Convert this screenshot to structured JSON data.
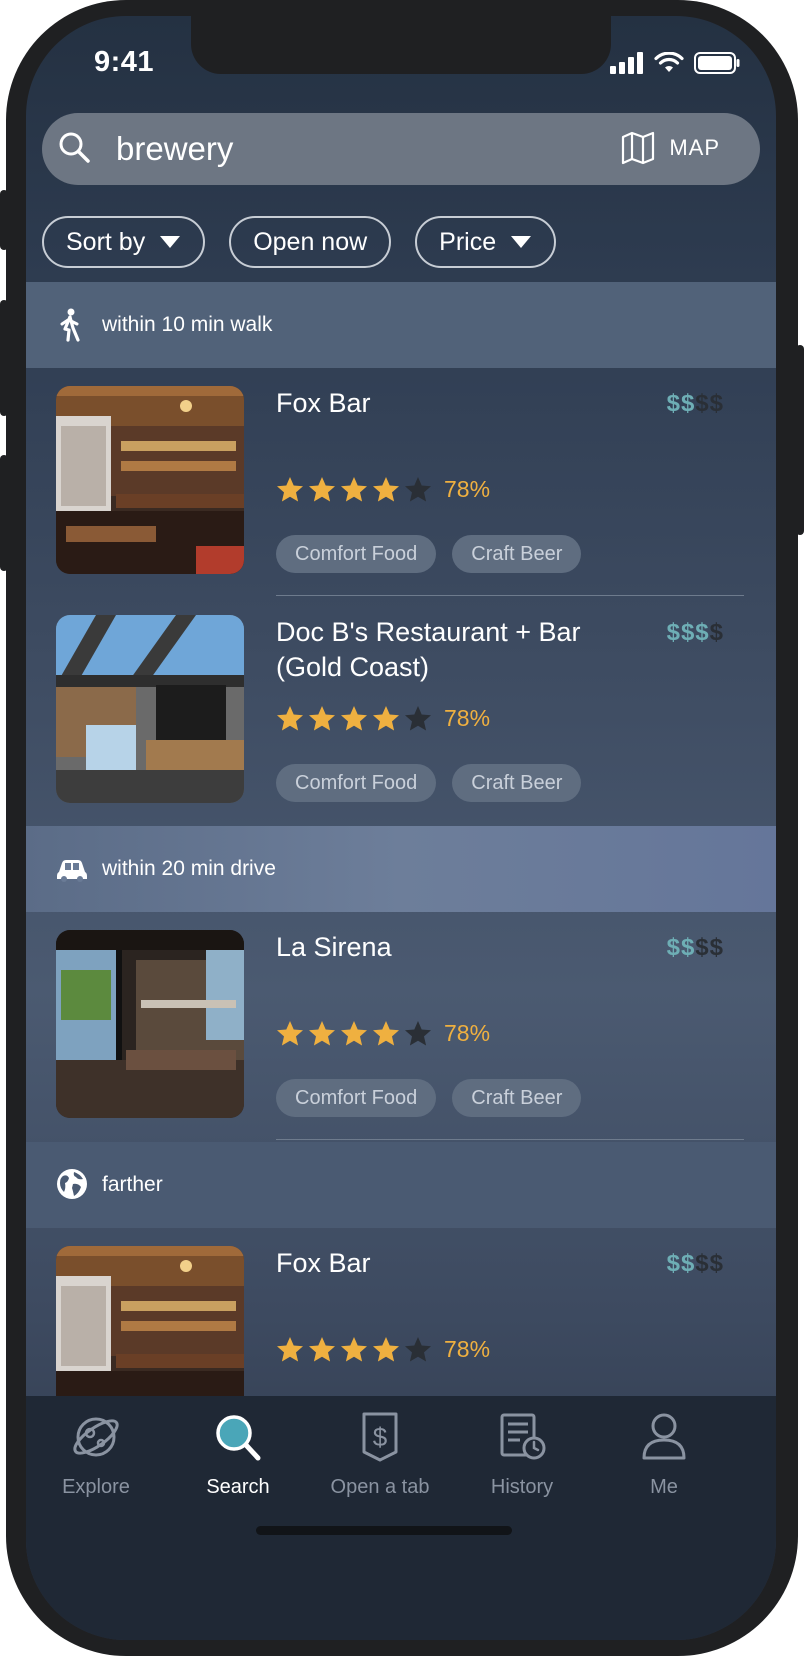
{
  "status_bar": {
    "time": "9:41"
  },
  "search": {
    "query": "brewery",
    "map_label": "MAP"
  },
  "filters": [
    {
      "label": "Sort by",
      "has_dropdown": true
    },
    {
      "label": "Open now",
      "has_dropdown": false
    },
    {
      "label": "Price",
      "has_dropdown": true
    }
  ],
  "sections": [
    {
      "label": "within 10 min walk",
      "icon": "walk-icon"
    },
    {
      "label": "within 20 min drive",
      "icon": "car-icon"
    },
    {
      "label": "farther",
      "icon": "globe-icon"
    }
  ],
  "results": [
    {
      "name": "Fox Bar",
      "price_level": 2,
      "price_max": 4,
      "rating_stars": 4,
      "rating_max": 5,
      "rating_pct": "78%",
      "tags": [
        "Comfort Food",
        "Craft Beer"
      ]
    },
    {
      "name": "Doc B's Restaurant + Bar (Gold Coast)",
      "price_level": 3,
      "price_max": 4,
      "rating_stars": 4,
      "rating_max": 5,
      "rating_pct": "78%",
      "tags": [
        "Comfort Food",
        "Craft Beer"
      ]
    },
    {
      "name": "La Sirena",
      "price_level": 2,
      "price_max": 4,
      "rating_stars": 4,
      "rating_max": 5,
      "rating_pct": "78%",
      "tags": [
        "Comfort Food",
        "Craft Beer"
      ]
    },
    {
      "name": "Fox Bar",
      "price_level": 2,
      "price_max": 4,
      "rating_stars": 4,
      "rating_max": 5,
      "rating_pct": "78%",
      "tags": []
    }
  ],
  "tabs": [
    {
      "label": "Explore",
      "icon": "planet-icon",
      "active": false
    },
    {
      "label": "Search",
      "icon": "search-icon",
      "active": true
    },
    {
      "label": "Open a tab",
      "icon": "dollar-tab-icon",
      "active": false
    },
    {
      "label": "History",
      "icon": "history-icon",
      "active": false
    },
    {
      "label": "Me",
      "icon": "person-icon",
      "active": false
    }
  ],
  "colors": {
    "star_on": "#efb040",
    "star_off": "#2a2f36",
    "price_on": "#6eaeb5",
    "price_off": "#2a2f36",
    "active_tab": "#ffffff",
    "inactive_tab": "#8a93a1"
  }
}
